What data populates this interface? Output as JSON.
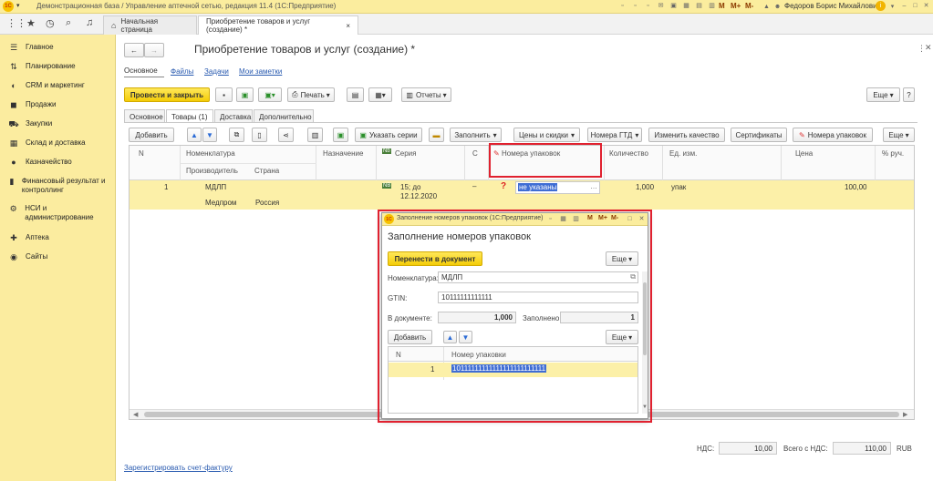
{
  "titlebar": {
    "logo": "1С",
    "title": "Демонстрационная база / Управление аптечной сетью, редакция 11.4 (1С:Предприятие)",
    "m_buttons": [
      "M",
      "M+",
      "M-"
    ],
    "user": "Федоров Борис Михайлович"
  },
  "navbar": {
    "tabs": [
      "Начальная страница",
      "Приобретение товаров и услуг (создание) *"
    ],
    "tab_close": "×"
  },
  "sidebar": {
    "items": [
      {
        "icon": "☰",
        "label": "Главное"
      },
      {
        "icon": "⇅",
        "label": "Планирование"
      },
      {
        "icon": "◐",
        "label": "CRM и маркетинг"
      },
      {
        "icon": "◼",
        "label": "Продажи"
      },
      {
        "icon": "⛟",
        "label": "Закупки"
      },
      {
        "icon": "▦",
        "label": "Склад и доставка"
      },
      {
        "icon": "●",
        "label": "Казначейство"
      },
      {
        "icon": "▮",
        "label": "Финансовый результат и контроллинг"
      },
      {
        "icon": "⚙",
        "label": "НСИ и администрирование"
      },
      {
        "icon": "✚",
        "label": "Аптека"
      },
      {
        "icon": "◉",
        "label": "Сайты"
      }
    ]
  },
  "document": {
    "title": "Приобретение товаров и услуг (создание) *",
    "nav_links": [
      "Основное",
      "Файлы",
      "Задачи",
      "Мои заметки"
    ],
    "toolbar": {
      "post_close": "Провести и закрыть",
      "print": "Печать",
      "reports": "Отчеты",
      "more": "Еще"
    },
    "form_tabs": [
      "Основное",
      "Товары (1)",
      "Доставка",
      "Дополнительно"
    ],
    "table_toolbar": {
      "add": "Добавить",
      "specify_series": "Указать серии",
      "fill": "Заполнить",
      "prices_discounts": "Цены и скидки",
      "gtd_numbers": "Номера ГТД",
      "change_quality": "Изменить качество",
      "certificates": "Сертификаты",
      "package_numbers": "Номера упаковок",
      "more": "Еще"
    },
    "columns": {
      "n": "N",
      "item": "Номенклатура",
      "manufacturer": "Производитель",
      "country": "Страна",
      "purpose": "Назначение",
      "series": "Серия",
      "s": "С",
      "package_numbers": "Номера упаковок",
      "quantity": "Количество",
      "unit": "Ед. изм.",
      "price": "Цена",
      "manual_pct": "% руч."
    },
    "rows": [
      {
        "n": "1",
        "item": "МДЛП",
        "manufacturer": "Медпром",
        "country": "Россия",
        "series_badge": "NB",
        "series": "15; до 12.12.2020",
        "s": "–",
        "status_icon": "?",
        "package_numbers": "не указаны",
        "quantity": "1,000",
        "unit": "упак",
        "price": "100,00"
      }
    ],
    "footer": {
      "vat_label": "НДС:",
      "vat_value": "10,00",
      "total_label": "Всего с НДС:",
      "total_value": "110,00",
      "currency": "RUB",
      "invoice_link": "Зарегистрировать счет-фактуру"
    }
  },
  "dialog": {
    "window_title": "Заполнение номеров упаковок (1С:Предприятие)",
    "m_buttons": [
      "M",
      "M+",
      "M-"
    ],
    "heading": "Заполнение номеров упаковок",
    "transfer_button": "Перенести в документ",
    "more": "Еще",
    "item_label": "Номенклатура:",
    "item_value": "МДЛП",
    "gtin_label": "GTIN:",
    "gtin_value": "10111111111111",
    "in_doc_label": "В документе:",
    "in_doc_value": "1,000",
    "filled_label": "Заполнено:",
    "filled_value": "1",
    "add_button": "Добавить",
    "columns": {
      "n": "N",
      "package_number": "Номер упаковки"
    },
    "rows": [
      {
        "n": "1",
        "package_number": "10111111111111111111111111"
      }
    ]
  },
  "colors": {
    "accent_yellow": "#fbed9e",
    "selected_row": "#fcf0a8",
    "highlight_red": "#e0212f",
    "link_blue": "#2a5bb0"
  }
}
